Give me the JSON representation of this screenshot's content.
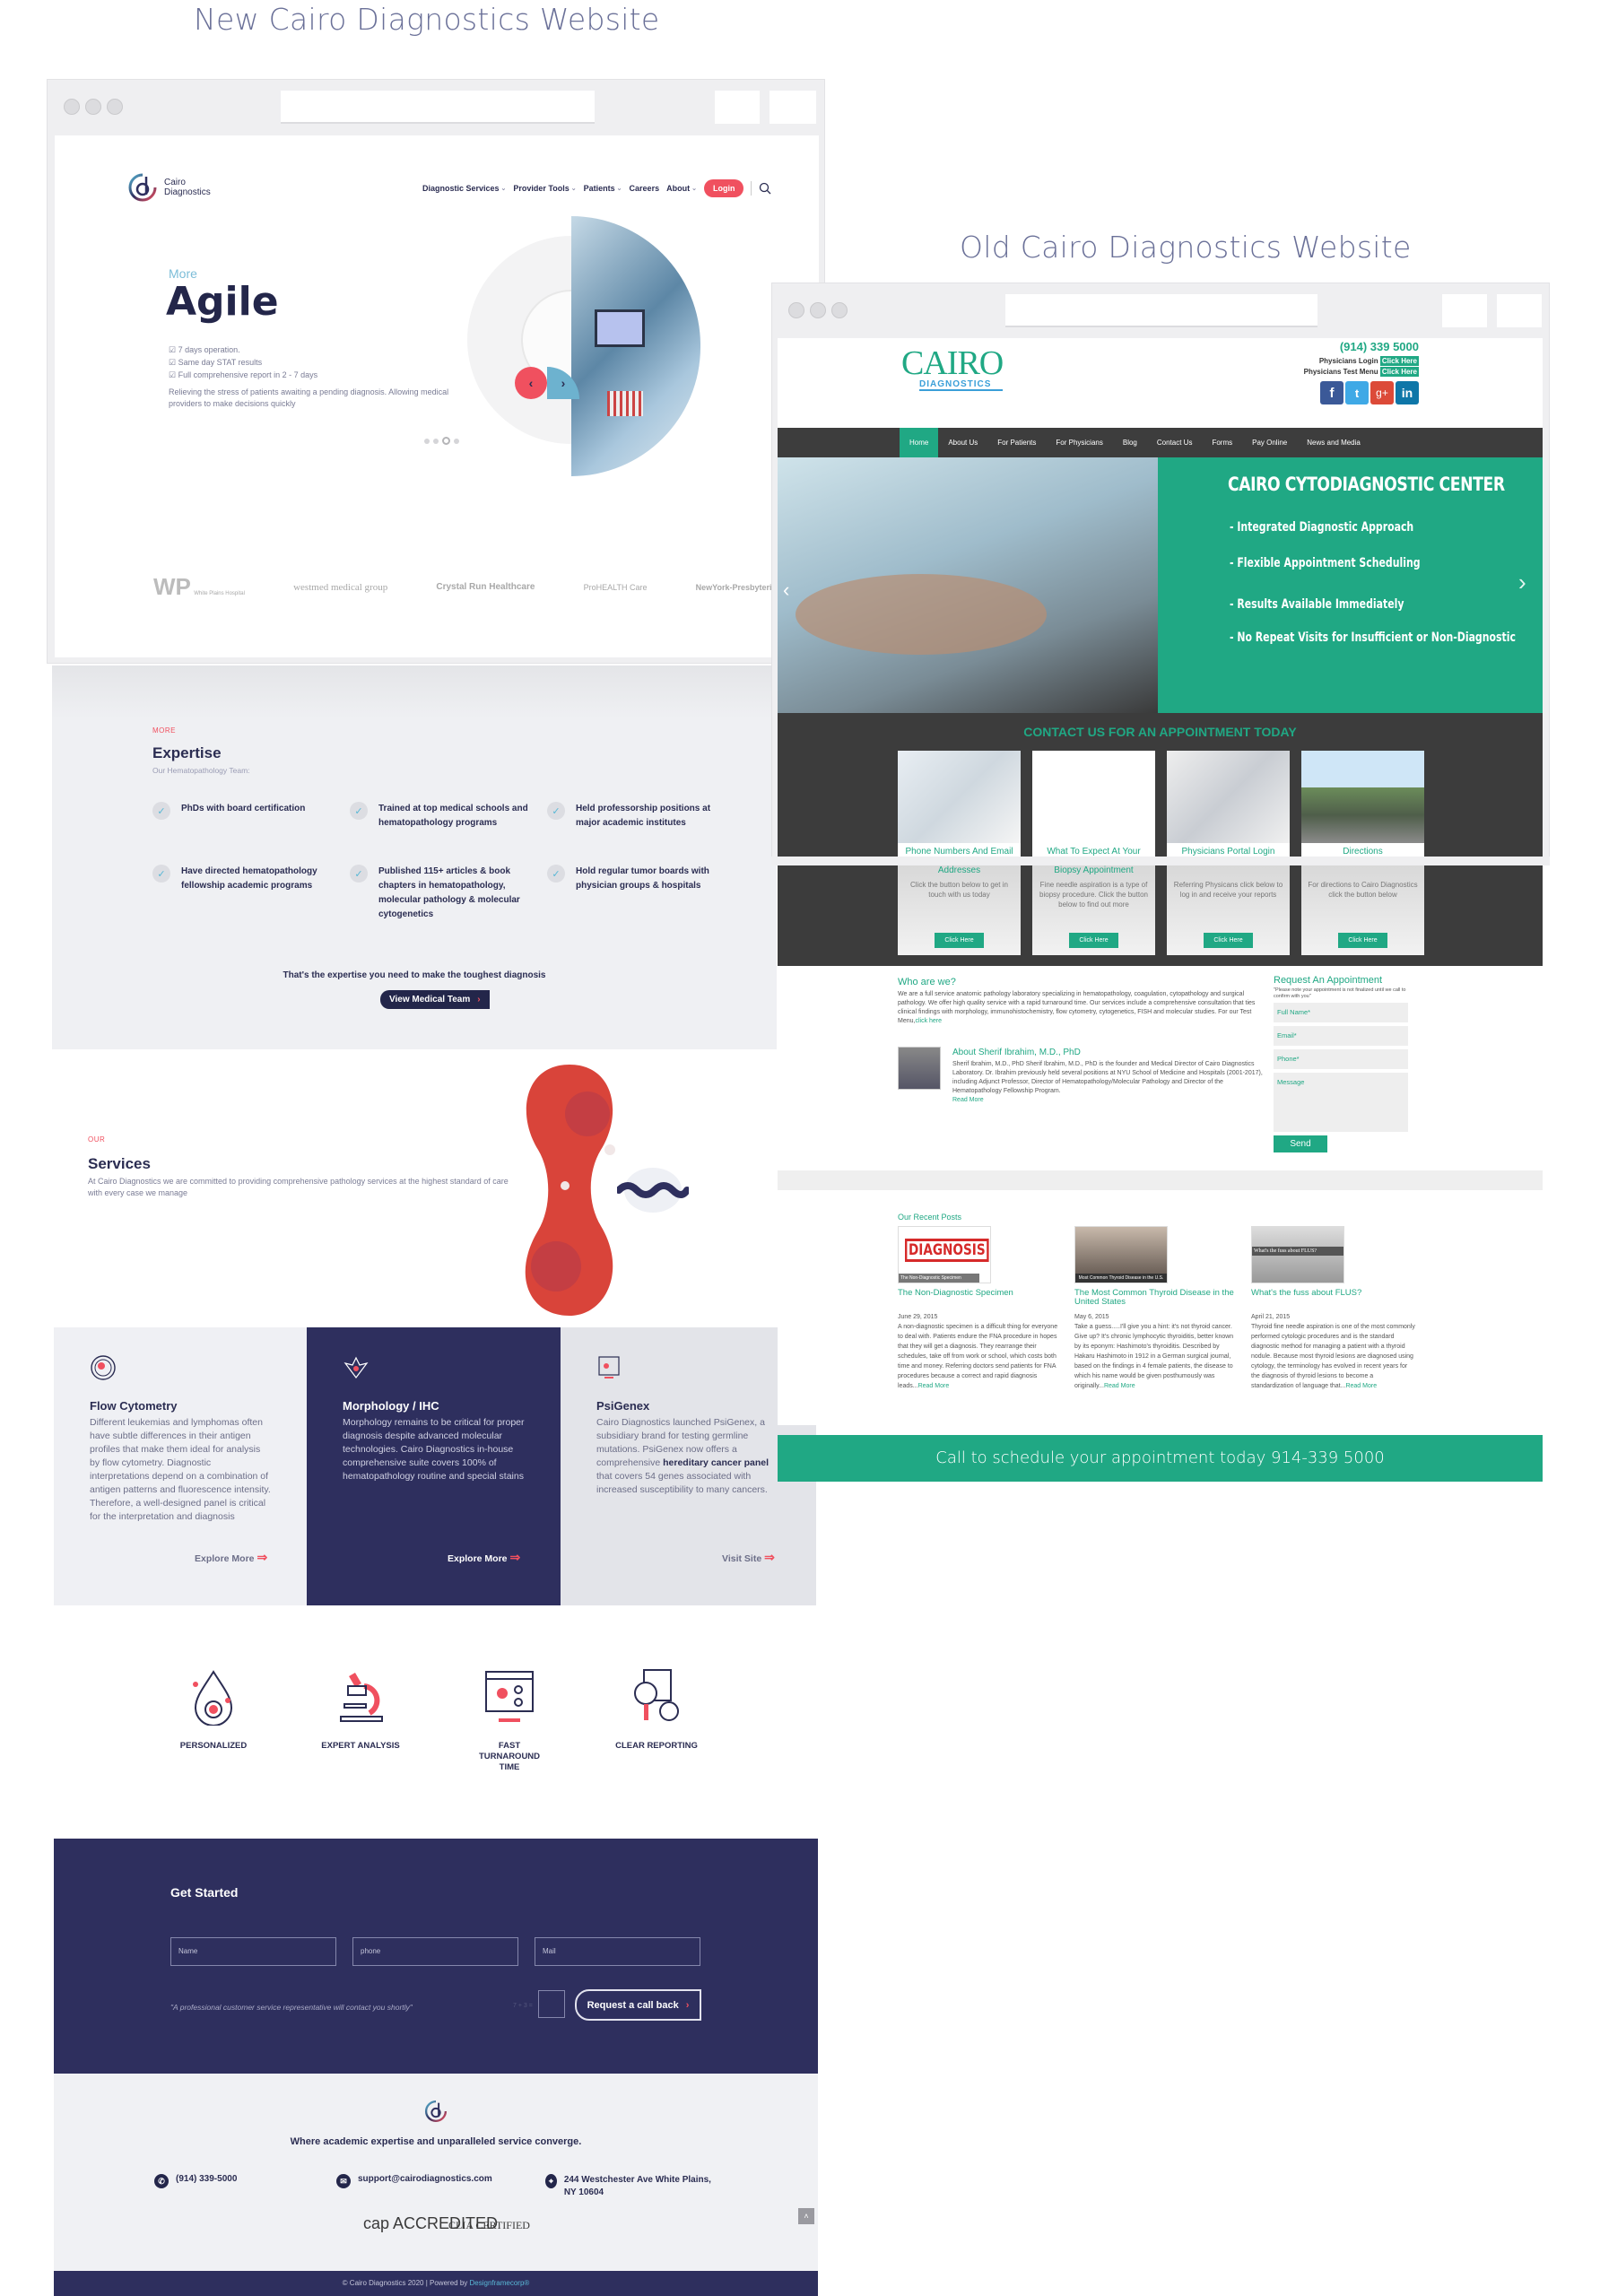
{
  "new_site": {
    "heading": "New Cairo Diagnostics Website",
    "logo": {
      "line1": "Cairo",
      "line2": "Diagnostics"
    },
    "nav": [
      {
        "label": "Diagnostic Services",
        "dropdown": true
      },
      {
        "label": "Provider Tools",
        "dropdown": true
      },
      {
        "label": "Patients",
        "dropdown": true
      },
      {
        "label": "Careers",
        "dropdown": false
      },
      {
        "label": "About",
        "dropdown": true
      }
    ],
    "login_label": "Login",
    "hero": {
      "kicker": "More",
      "title": "Agile",
      "bullets": [
        "7 days operation.",
        "Same day STAT results",
        "Full comprehensive report in 2 - 7 days"
      ],
      "description": "Relieving the stress of patients awaiting a pending diagnosis. Allowing medical providers to make decisions quickly",
      "prev_icon": "chevron-left",
      "next_icon": "chevron-right",
      "slides_total": 4,
      "active_slide": 3
    },
    "partners": [
      "White Plains Hospital",
      "westmed medical group",
      "Crystal Run Healthcare",
      "ProHEALTH Care",
      "NewYork-Presbyterian"
    ],
    "expertise": {
      "kicker": "MORE",
      "title": "Expertise",
      "subtitle": "Our Hematopathology Team:",
      "items": [
        "PhDs with board certification",
        "Trained at top medical schools and hematopathology programs",
        "Held professorship positions at major academic institutes",
        "Have directed hematopathology fellowship academic programs",
        "Published 115+ articles & book chapters in hematopathology, molecular pathology & molecular cytogenetics",
        "Hold regular tumor boards with physician groups & hospitals"
      ],
      "tagline": "That's the expertise you need to make the toughest diagnosis",
      "button": "View Medical Team"
    },
    "services": {
      "kicker": "OUR",
      "title": "Services",
      "description": "At Cairo Diagnostics we are committed to providing comprehensive pathology services at the highest standard of care with every case we manage",
      "cards": [
        {
          "title": "Flow Cytometry",
          "text": "Different leukemias and lymphomas often have subtle differences in their antigen profiles that make them ideal for analysis by flow cytometry. Diagnostic interpretations depend on a combination of antigen patterns and fluorescence intensity. Therefore, a well-designed panel is critical for the interpretation and diagnosis",
          "link": "Explore More"
        },
        {
          "title": "Morphology / IHC",
          "text": "Morphology remains to be critical for proper diagnosis despite advanced molecular technologies. Cairo Diagnostics in-house comprehensive suite covers 100% of hematopathology routine and special stains",
          "link": "Explore More"
        },
        {
          "title": "PsiGenex",
          "text_before": "Cairo Diagnostics launched PsiGenex, a subsidiary brand for testing germline mutations. PsiGenex now offers a comprehensive ",
          "text_bold": "hereditary cancer panel",
          "text_after": " that covers 54 genes associated with increased susceptibility to many cancers.",
          "link": "Visit Site"
        }
      ]
    },
    "features": [
      "PERSONALIZED",
      "EXPERT ANALYSIS",
      "FAST TURNAROUND TIME",
      "CLEAR REPORTING"
    ],
    "get_started": {
      "title": "Get Started",
      "name_placeholder": "Name",
      "phone_placeholder": "phone",
      "mail_placeholder": "Mail",
      "note": "\"A professional customer service representative will contact you shortly\"",
      "captcha": "7 + 3 =",
      "button": "Request a call back"
    },
    "footer": {
      "tagline": "Where academic expertise and unparalleled service converge.",
      "phone": "(914) 339-5000",
      "email": "support@cairodiagnostics.com",
      "address": "244 Westchester Ave White Plains, NY 10604",
      "badges": [
        "cap ACCREDITED",
        "CLIA CERTIFIED"
      ],
      "copyright": "© Cairo Diagnostics 2020 | Powered by ",
      "powered_by": "Designframecorp®"
    },
    "colors": {
      "navy": "#2e2f5e",
      "red": "#f0505f",
      "blue": "#7cbdd8"
    }
  },
  "old_site": {
    "heading": "Old Cairo Diagnostics Website",
    "logo": {
      "main": "CAIRO",
      "sub": "DIAGNOSTICS"
    },
    "phone": "(914) 339 5000",
    "physicians_login": "Physicians Login",
    "physicians_test_menu": "Physicians Test Menu",
    "click_here": "Click Here",
    "social": [
      "f",
      "t",
      "g+",
      "in"
    ],
    "nav": [
      "Home",
      "About Us",
      "For Patients",
      "For Physicians",
      "Blog",
      "Contact Us",
      "Forms",
      "Pay Online",
      "News and Media"
    ],
    "active_nav": "Home",
    "hero": {
      "title": "CAIRO CYTODIAGNOSTIC CENTER",
      "items": [
        "- Integrated Diagnostic Approach",
        "- Flexible Appointment Scheduling",
        "- Results Available Immediately",
        "- No Repeat Visits for Insufficient or Non-Diagnostic"
      ]
    },
    "contact": {
      "title": "CONTACT US FOR AN APPOINTMENT TODAY",
      "cards": [
        {
          "title": "Phone Numbers And Email Addresses",
          "lower_title": "Addresses",
          "text": "Click the button below to get in touch with us today",
          "button": "Click Here"
        },
        {
          "title": "What To Expect At Your Biopsy Appointment",
          "lower_title": "Biopsy Appointment",
          "text": "Fine needle aspiration is a type of biopsy procedure. Click the button below to find out more",
          "button": "Click Here"
        },
        {
          "title": "Physicians Portal Login",
          "lower_title": "",
          "text": "Referring Physicans click below to log in and receive your reports",
          "button": "Click Here"
        },
        {
          "title": "Directions",
          "lower_title": "",
          "text": "For directions to Cairo Diagnostics click the button below",
          "button": "Click Here"
        }
      ]
    },
    "who": {
      "title": "Who are we?",
      "text": "We are a full service anatomic pathology laboratory specializing in hematopathology, coagulation, cytopathology and surgical pathology. We offer high quality service with a rapid turnaround time. Our services include a comprehensive consultation that ties clinical findings with morphology, immunohistochemistry, flow cytometry, cytogenetics, FISH and molecular studies. For our Test Menu,",
      "link": "click here",
      "about_title": "About Sherif Ibrahim, M.D., PhD",
      "about_text": "Sherif Ibrahim, M.D., PhD Sherif Ibrahim, M.D., PhD is the founder and Medical Director of Cairo Diagnostics Laboratory. Dr. Ibrahim previously held several positions at NYU School of Medicine and Hospitals (2001-2017), including Adjunct Professor, Director of Hematopathology/Molecular Pathology and Director of the Hematopathology Fellowship Program.",
      "read_more": "Read More"
    },
    "appointment": {
      "title": "Request An Appointment",
      "note": "\"Please note your appointment is not finalized until we call to confirm with you\"",
      "fields": [
        "Full Name*",
        "Email*",
        "Phone*",
        "Message"
      ],
      "button": "Send"
    },
    "posts": {
      "title": "Our Recent Posts",
      "items": [
        {
          "image_caption": "The Non-Diagnostic Specimen",
          "image_label": "DIAGNOSIS",
          "title": "The Non-Diagnostic Specimen",
          "date": "June 29, 2015",
          "text": "A non-diagnostic specimen is a difficult thing for everyone to deal with. Patients endure the FNA procedure in hopes that they will get a diagnosis. They rearrange their schedules, take off from work or school, which costs both time and money. Referring doctors send patients for FNA procedures because a correct and rapid diagnosis leads...",
          "read_more": "Read More"
        },
        {
          "image_caption": "Most Common Thyroid Disease in the U.S.",
          "title": "The Most Common Thyroid Disease in the United States",
          "date": "May 6, 2015",
          "text": "Take a guess.....I'll give you a hint: it's not thyroid cancer. Give up? It's chronic lymphocytic thyroiditis, better known by its eponym: Hashimoto's thyroiditis. Described by Hakaru Hashimoto in 1912 in a German surgical journal, based on the findings in 4 female patients, the disease to which his name would be given posthumously was originally...",
          "read_more": "Read More"
        },
        {
          "image_caption": "What's the fuss about FLUS?",
          "title": "What's the fuss about FLUS?",
          "date": "April 21, 2015",
          "text": "Thyroid fine needle aspiration is one of the most commonly performed cytologic procedures and is the standard diagnostic method for managing a patient with a thyroid nodule. Because most thyroid lesions are diagnosed using cytology, the terminology has evolved in recent years for the diagnosis of thyroid lesions to become a standardization of language that...",
          "read_more": "Read More"
        }
      ]
    },
    "call_bar": "Call to schedule your appointment today 914-339 5000",
    "colors": {
      "green": "#20a884",
      "dark": "#3d3d3d"
    }
  }
}
